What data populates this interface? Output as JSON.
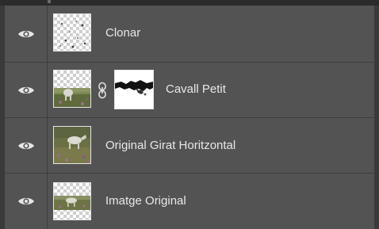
{
  "layers_panel": {
    "layers": [
      {
        "name": "Clonar",
        "visible": true,
        "thumbnail": "transparent-with-specks",
        "has_mask": false
      },
      {
        "name": "Cavall Petit",
        "visible": true,
        "thumbnail": "horse-photo-partial",
        "has_mask": true,
        "linked": true
      },
      {
        "name": "Original Girat Horitzontal",
        "visible": true,
        "thumbnail": "horse-photo-full",
        "has_mask": false
      },
      {
        "name": "Imatge Original",
        "visible": true,
        "thumbnail": "horse-photo-strip",
        "has_mask": false
      }
    ],
    "icons": {
      "visibility": "eye-icon",
      "link": "chain-link-icon"
    },
    "colors": {
      "panel_bg": "#535353",
      "divider": "#3d3d3d",
      "text": "#e8e8e8"
    }
  }
}
